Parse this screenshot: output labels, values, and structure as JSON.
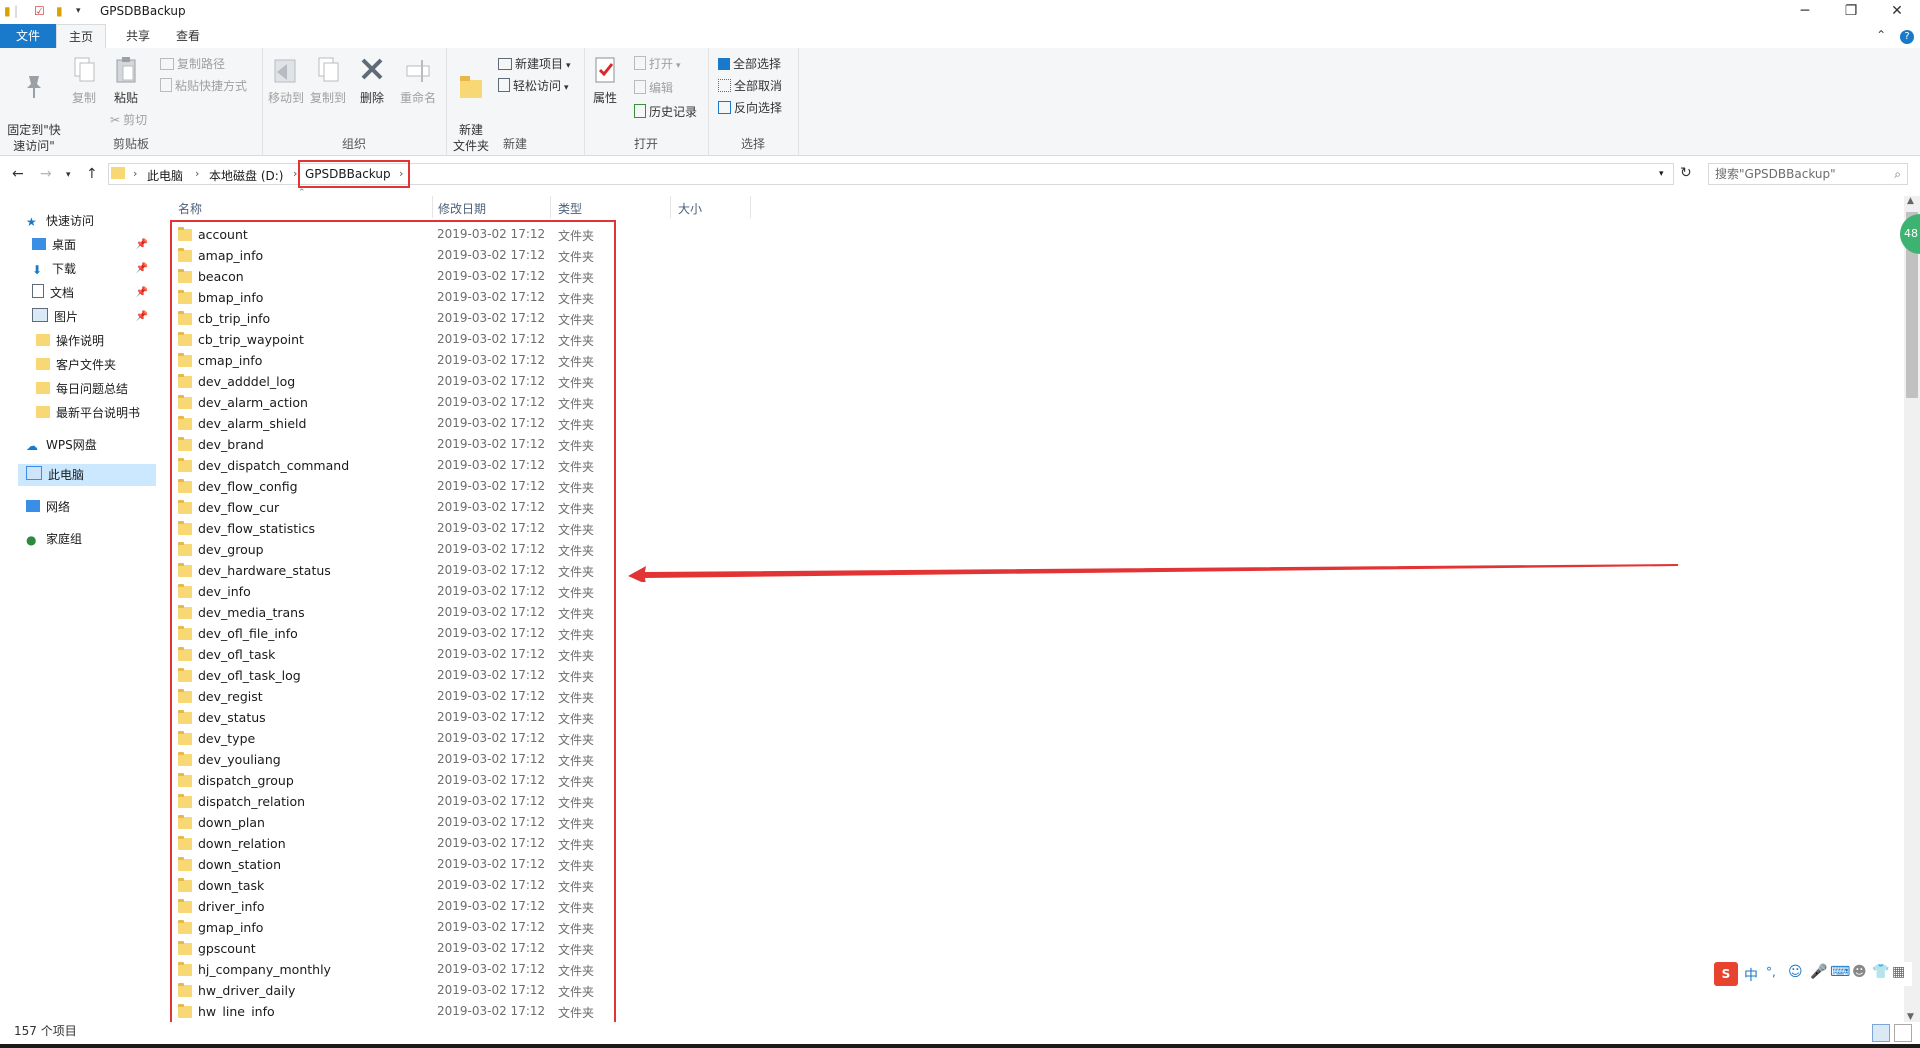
{
  "window": {
    "title": "GPSDBBackup",
    "minimize": "─",
    "maximize": "❐",
    "close": "✕"
  },
  "ribbon_tabs": [
    "文件",
    "主页",
    "共享",
    "查看"
  ],
  "ribbon": {
    "clipboard": {
      "label": "剪贴板",
      "pin": "固定到\"快\n速访问\"",
      "copy": "复制",
      "paste": "粘贴",
      "copy_path": "复制路径",
      "paste_shortcut": "粘贴快捷方式",
      "cut": "剪切"
    },
    "organize": {
      "label": "组织",
      "move_to": "移动到",
      "copy_to": "复制到",
      "delete": "删除",
      "rename": "重命名"
    },
    "new": {
      "label": "新建",
      "new_folder": "新建\n文件夹",
      "new_item": "新建项目",
      "easy_access": "轻松访问"
    },
    "open": {
      "label": "打开",
      "properties": "属性",
      "open": "打开",
      "edit": "编辑",
      "history": "历史记录"
    },
    "select": {
      "label": "选择",
      "select_all": "全部选择",
      "select_none": "全部取消",
      "invert": "反向选择"
    }
  },
  "address": {
    "crumbs": [
      "此电脑",
      "本地磁盘 (D:)",
      "GPSDBBackup"
    ],
    "search_placeholder": "搜索\"GPSDBBackup\""
  },
  "nav": {
    "quick_access": "快速访问",
    "desktop": "桌面",
    "downloads": "下载",
    "documents": "文档",
    "pictures": "图片",
    "folder1": "操作说明",
    "folder2": "客户文件夹",
    "folder3": "每日问题总结",
    "folder4": "最新平台说明书",
    "wps": "WPS网盘",
    "thispc": "此电脑",
    "network": "网络",
    "homegroup": "家庭组"
  },
  "columns": {
    "name": "名称",
    "date": "修改日期",
    "type": "类型",
    "size": "大小"
  },
  "files": [
    {
      "name": "account",
      "date": "2019-03-02 17:12",
      "type": "文件夹"
    },
    {
      "name": "amap_info",
      "date": "2019-03-02 17:12",
      "type": "文件夹"
    },
    {
      "name": "beacon",
      "date": "2019-03-02 17:12",
      "type": "文件夹"
    },
    {
      "name": "bmap_info",
      "date": "2019-03-02 17:12",
      "type": "文件夹"
    },
    {
      "name": "cb_trip_info",
      "date": "2019-03-02 17:12",
      "type": "文件夹"
    },
    {
      "name": "cb_trip_waypoint",
      "date": "2019-03-02 17:12",
      "type": "文件夹"
    },
    {
      "name": "cmap_info",
      "date": "2019-03-02 17:12",
      "type": "文件夹"
    },
    {
      "name": "dev_adddel_log",
      "date": "2019-03-02 17:12",
      "type": "文件夹"
    },
    {
      "name": "dev_alarm_action",
      "date": "2019-03-02 17:12",
      "type": "文件夹"
    },
    {
      "name": "dev_alarm_shield",
      "date": "2019-03-02 17:12",
      "type": "文件夹"
    },
    {
      "name": "dev_brand",
      "date": "2019-03-02 17:12",
      "type": "文件夹"
    },
    {
      "name": "dev_dispatch_command",
      "date": "2019-03-02 17:12",
      "type": "文件夹"
    },
    {
      "name": "dev_flow_config",
      "date": "2019-03-02 17:12",
      "type": "文件夹"
    },
    {
      "name": "dev_flow_cur",
      "date": "2019-03-02 17:12",
      "type": "文件夹"
    },
    {
      "name": "dev_flow_statistics",
      "date": "2019-03-02 17:12",
      "type": "文件夹"
    },
    {
      "name": "dev_group",
      "date": "2019-03-02 17:12",
      "type": "文件夹"
    },
    {
      "name": "dev_hardware_status",
      "date": "2019-03-02 17:12",
      "type": "文件夹"
    },
    {
      "name": "dev_info",
      "date": "2019-03-02 17:12",
      "type": "文件夹"
    },
    {
      "name": "dev_media_trans",
      "date": "2019-03-02 17:12",
      "type": "文件夹"
    },
    {
      "name": "dev_ofl_file_info",
      "date": "2019-03-02 17:12",
      "type": "文件夹"
    },
    {
      "name": "dev_ofl_task",
      "date": "2019-03-02 17:12",
      "type": "文件夹"
    },
    {
      "name": "dev_ofl_task_log",
      "date": "2019-03-02 17:12",
      "type": "文件夹"
    },
    {
      "name": "dev_regist",
      "date": "2019-03-02 17:12",
      "type": "文件夹"
    },
    {
      "name": "dev_status",
      "date": "2019-03-02 17:12",
      "type": "文件夹"
    },
    {
      "name": "dev_type",
      "date": "2019-03-02 17:12",
      "type": "文件夹"
    },
    {
      "name": "dev_youliang",
      "date": "2019-03-02 17:12",
      "type": "文件夹"
    },
    {
      "name": "dispatch_group",
      "date": "2019-03-02 17:12",
      "type": "文件夹"
    },
    {
      "name": "dispatch_relation",
      "date": "2019-03-02 17:12",
      "type": "文件夹"
    },
    {
      "name": "down_plan",
      "date": "2019-03-02 17:12",
      "type": "文件夹"
    },
    {
      "name": "down_relation",
      "date": "2019-03-02 17:12",
      "type": "文件夹"
    },
    {
      "name": "down_station",
      "date": "2019-03-02 17:12",
      "type": "文件夹"
    },
    {
      "name": "down_task",
      "date": "2019-03-02 17:12",
      "type": "文件夹"
    },
    {
      "name": "driver_info",
      "date": "2019-03-02 17:12",
      "type": "文件夹"
    },
    {
      "name": "gmap_info",
      "date": "2019-03-02 17:12",
      "type": "文件夹"
    },
    {
      "name": "gpscount",
      "date": "2019-03-02 17:12",
      "type": "文件夹"
    },
    {
      "name": "hj_company_monthly",
      "date": "2019-03-02 17:12",
      "type": "文件夹"
    },
    {
      "name": "hw_driver_daily",
      "date": "2019-03-02 17:12",
      "type": "文件夹"
    },
    {
      "name": "hw_line_info",
      "date": "2019-03-02 17:12",
      "type": "文件夹"
    }
  ],
  "status": {
    "count": "157 个项目"
  },
  "ime": {
    "lang": "中"
  },
  "badge": "48",
  "colors": {
    "accent": "#1979ca",
    "highlight": "#e23434",
    "folder": "#f8d775"
  }
}
